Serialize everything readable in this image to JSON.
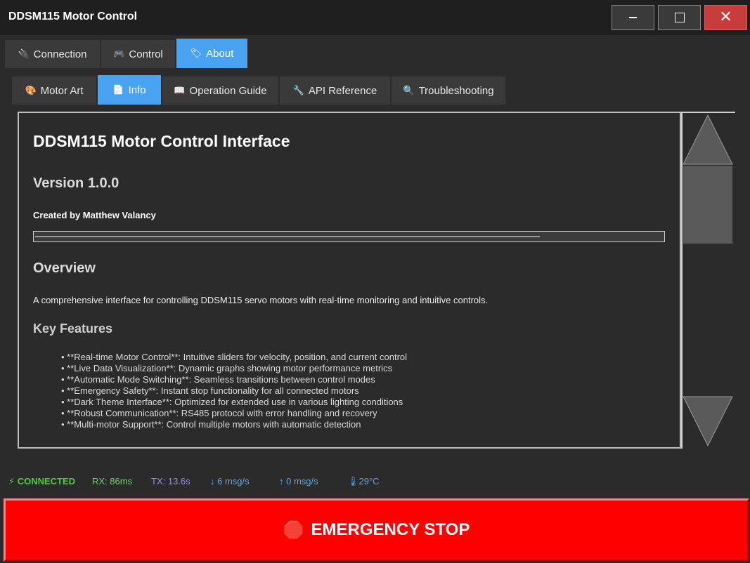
{
  "window": {
    "title": "DDSM115 Motor Control",
    "controls": {
      "minimize": "minimize-icon",
      "maximize": "maximize-icon",
      "close": "close-icon"
    }
  },
  "main_tabs": [
    {
      "icon": "🔌",
      "label": "Connection",
      "active": false
    },
    {
      "icon": "🎮",
      "label": "Control",
      "active": false
    },
    {
      "icon": "🏷",
      "label": "About",
      "active": true
    }
  ],
  "sub_tabs": [
    {
      "icon": "🎨",
      "label": "Motor Art",
      "active": false
    },
    {
      "icon": "📄",
      "label": "Info",
      "active": true
    },
    {
      "icon": "📖",
      "label": "Operation Guide",
      "active": false
    },
    {
      "icon": "🔧",
      "label": "API Reference",
      "active": false
    },
    {
      "icon": "🔍",
      "label": "Troubleshooting",
      "active": false
    }
  ],
  "content": {
    "title": "DDSM115 Motor Control Interface",
    "version": "Version 1.0.0",
    "author": "Created by Matthew Valancy",
    "overview_heading": "Overview",
    "overview_text": "A comprehensive interface for controlling DDSM115 servo motors with real-time monitoring and intuitive controls.",
    "features_heading": "Key Features",
    "features": [
      "• **Real-time Motor Control**: Intuitive sliders for velocity, position, and current control",
      "• **Live Data Visualization**: Dynamic graphs showing motor performance metrics",
      "• **Automatic Mode Switching**: Seamless transitions between control modes",
      "• **Emergency Safety**: Instant stop functionality for all connected motors",
      "• **Dark Theme Interface**: Optimized for extended use in various lighting conditions",
      "• **Robust Communication**: RS485 protocol with error handling and recovery",
      "• **Multi-motor Support**: Control multiple motors with automatic detection"
    ]
  },
  "status_bar": {
    "connection": "⚡ CONNECTED",
    "rx": "RX: 86ms",
    "tx": "TX: 13.6s",
    "down_rate": "↓ 6 msg/s",
    "up_rate": "↑ 0 msg/s",
    "temp_icon": "🌡",
    "temperature": "29°C"
  },
  "emergency": {
    "icon": "🛑",
    "label": "EMERGENCY STOP"
  },
  "colors": {
    "accent": "#4aa3f0",
    "connected": "#4cd13c",
    "rx": "#7ad06a",
    "tx": "#a08ae6",
    "rate": "#5aa8e8",
    "danger": "#ff0000",
    "close_button": "#c83c3c"
  }
}
